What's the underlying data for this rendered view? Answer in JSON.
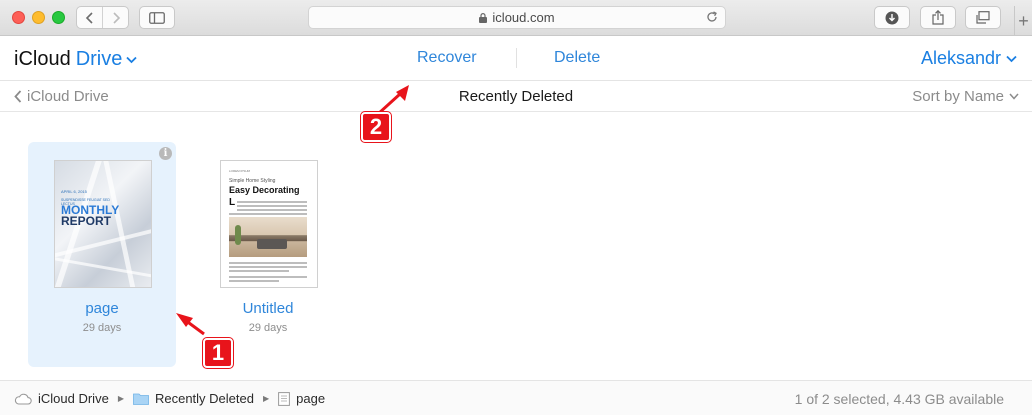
{
  "browser": {
    "url": "icloud.com",
    "icons": [
      "back-icon",
      "forward-icon",
      "sidebar-icon",
      "lock-icon",
      "reload-icon",
      "download-icon",
      "share-icon",
      "tabs-icon",
      "plus-icon"
    ],
    "new_tab": "+"
  },
  "header": {
    "brand_prefix": "iCloud",
    "brand_drive": "Drive",
    "recover": "Recover",
    "delete": "Delete",
    "user": "Aleksandr"
  },
  "subbar": {
    "back_label": "iCloud Drive",
    "title": "Recently Deleted",
    "sort_label": "Sort by Name"
  },
  "items": [
    {
      "name": "page",
      "date": "29 days",
      "selected": true,
      "thumb": {
        "date_line": "APRIL 6, 2015",
        "sub": "SUSPENDISSE FEUGIAT SED LECTUS",
        "title_1": "MONTHLY",
        "title_2": "REPORT"
      }
    },
    {
      "name": "Untitled",
      "date": "29 days",
      "selected": false,
      "thumb": {
        "head": "LOREM IPSUM",
        "kicker": "Simple Home Styling",
        "title": "Easy Decorating",
        "dropcap": "L"
      }
    }
  ],
  "annotations": {
    "one": "1",
    "two": "2"
  },
  "footer": {
    "crumbs": [
      "iCloud Drive",
      "Recently Deleted",
      "page"
    ],
    "separator": "▶",
    "status": "1 of 2 selected, 4.43 GB available"
  },
  "colors": {
    "accent": "#1a7fe2",
    "badge": "#e8141b",
    "selection": "#e6f2fd"
  }
}
